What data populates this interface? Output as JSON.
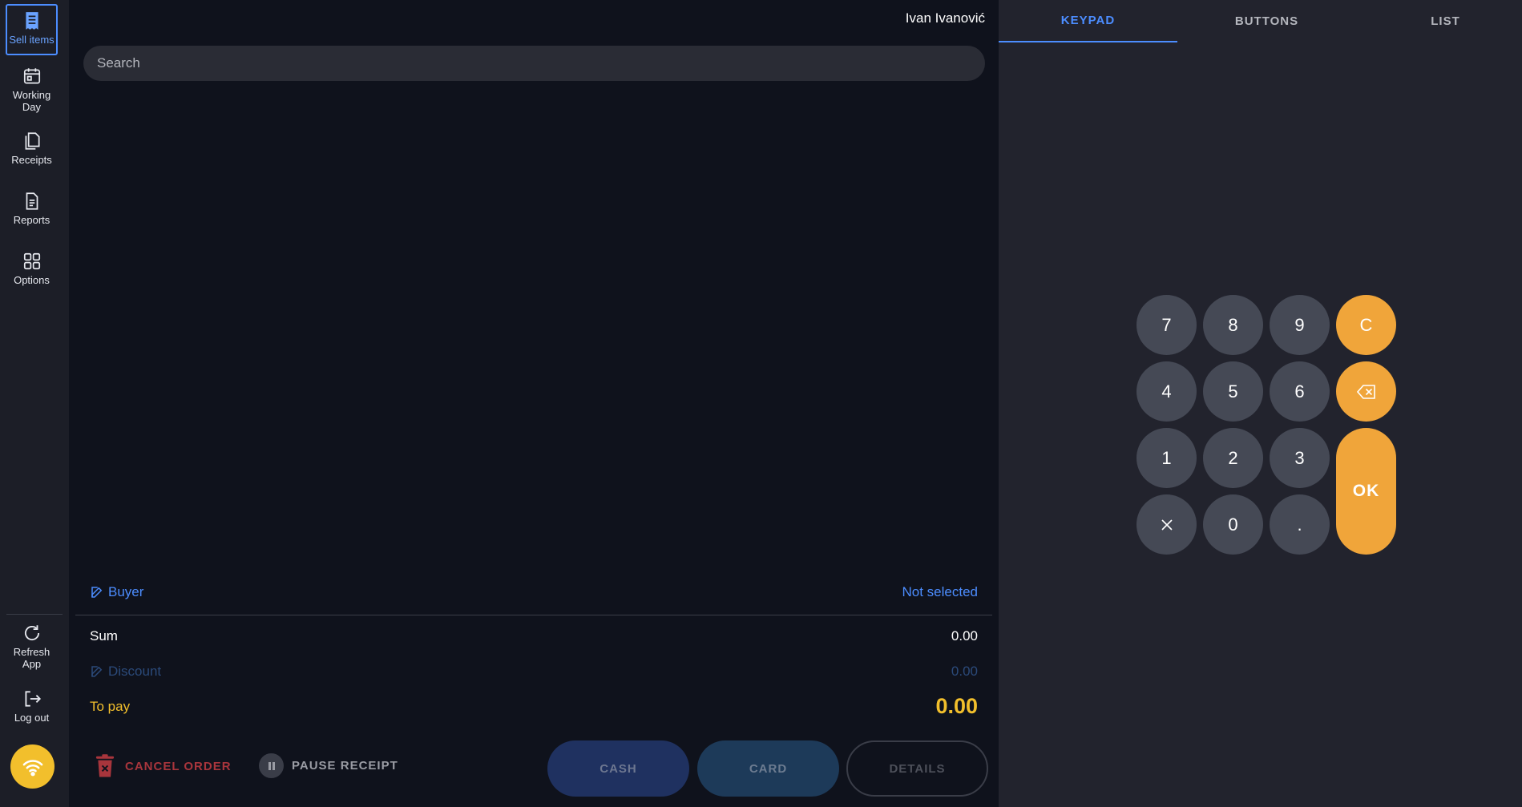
{
  "sidebar": {
    "items": [
      {
        "label": "Sell items"
      },
      {
        "label": "Working\nDay"
      },
      {
        "label": "Receipts"
      },
      {
        "label": "Reports"
      },
      {
        "label": "Options"
      }
    ],
    "bottom": [
      {
        "label": "Refresh\nApp"
      },
      {
        "label": "Log out"
      }
    ]
  },
  "header": {
    "user_name": "Ivan Ivanović"
  },
  "search": {
    "placeholder": "Search"
  },
  "summary": {
    "buyer_label": "Buyer",
    "buyer_value": "Not selected",
    "sum_label": "Sum",
    "sum_value": "0.00",
    "discount_label": "Discount",
    "discount_value": "0.00",
    "topay_label": "To pay",
    "topay_value": "0.00"
  },
  "actions": {
    "cancel_label": "CANCEL ORDER",
    "pause_label": "PAUSE RECEIPT",
    "cash_label": "CASH",
    "card_label": "CARD",
    "details_label": "DETAILS"
  },
  "tabs": [
    {
      "label": "KEYPAD"
    },
    {
      "label": "BUTTONS"
    },
    {
      "label": "LIST"
    }
  ],
  "keypad": {
    "k7": "7",
    "k8": "8",
    "k9": "9",
    "clear": "C",
    "k4": "4",
    "k5": "5",
    "k6": "6",
    "k1": "1",
    "k2": "2",
    "k3": "3",
    "ok": "OK",
    "k0": "0",
    "dot": "."
  },
  "colors": {
    "accent": "#4c8dff",
    "to_pay": "#f2bf2c",
    "keypad_action": "#f0a53a",
    "cancel": "#a8353c"
  },
  "icons": {
    "sell_items": "receipt-icon",
    "working_day": "calendar-icon",
    "receipts": "documents-icon",
    "reports": "document-icon",
    "options": "grid-icon",
    "refresh": "refresh-icon",
    "logout": "logout-icon",
    "wifi": "wifi-icon",
    "edit": "edit-icon",
    "trash": "trash-icon",
    "pause": "pause-icon",
    "backspace": "backspace-icon",
    "close": "close-icon"
  }
}
